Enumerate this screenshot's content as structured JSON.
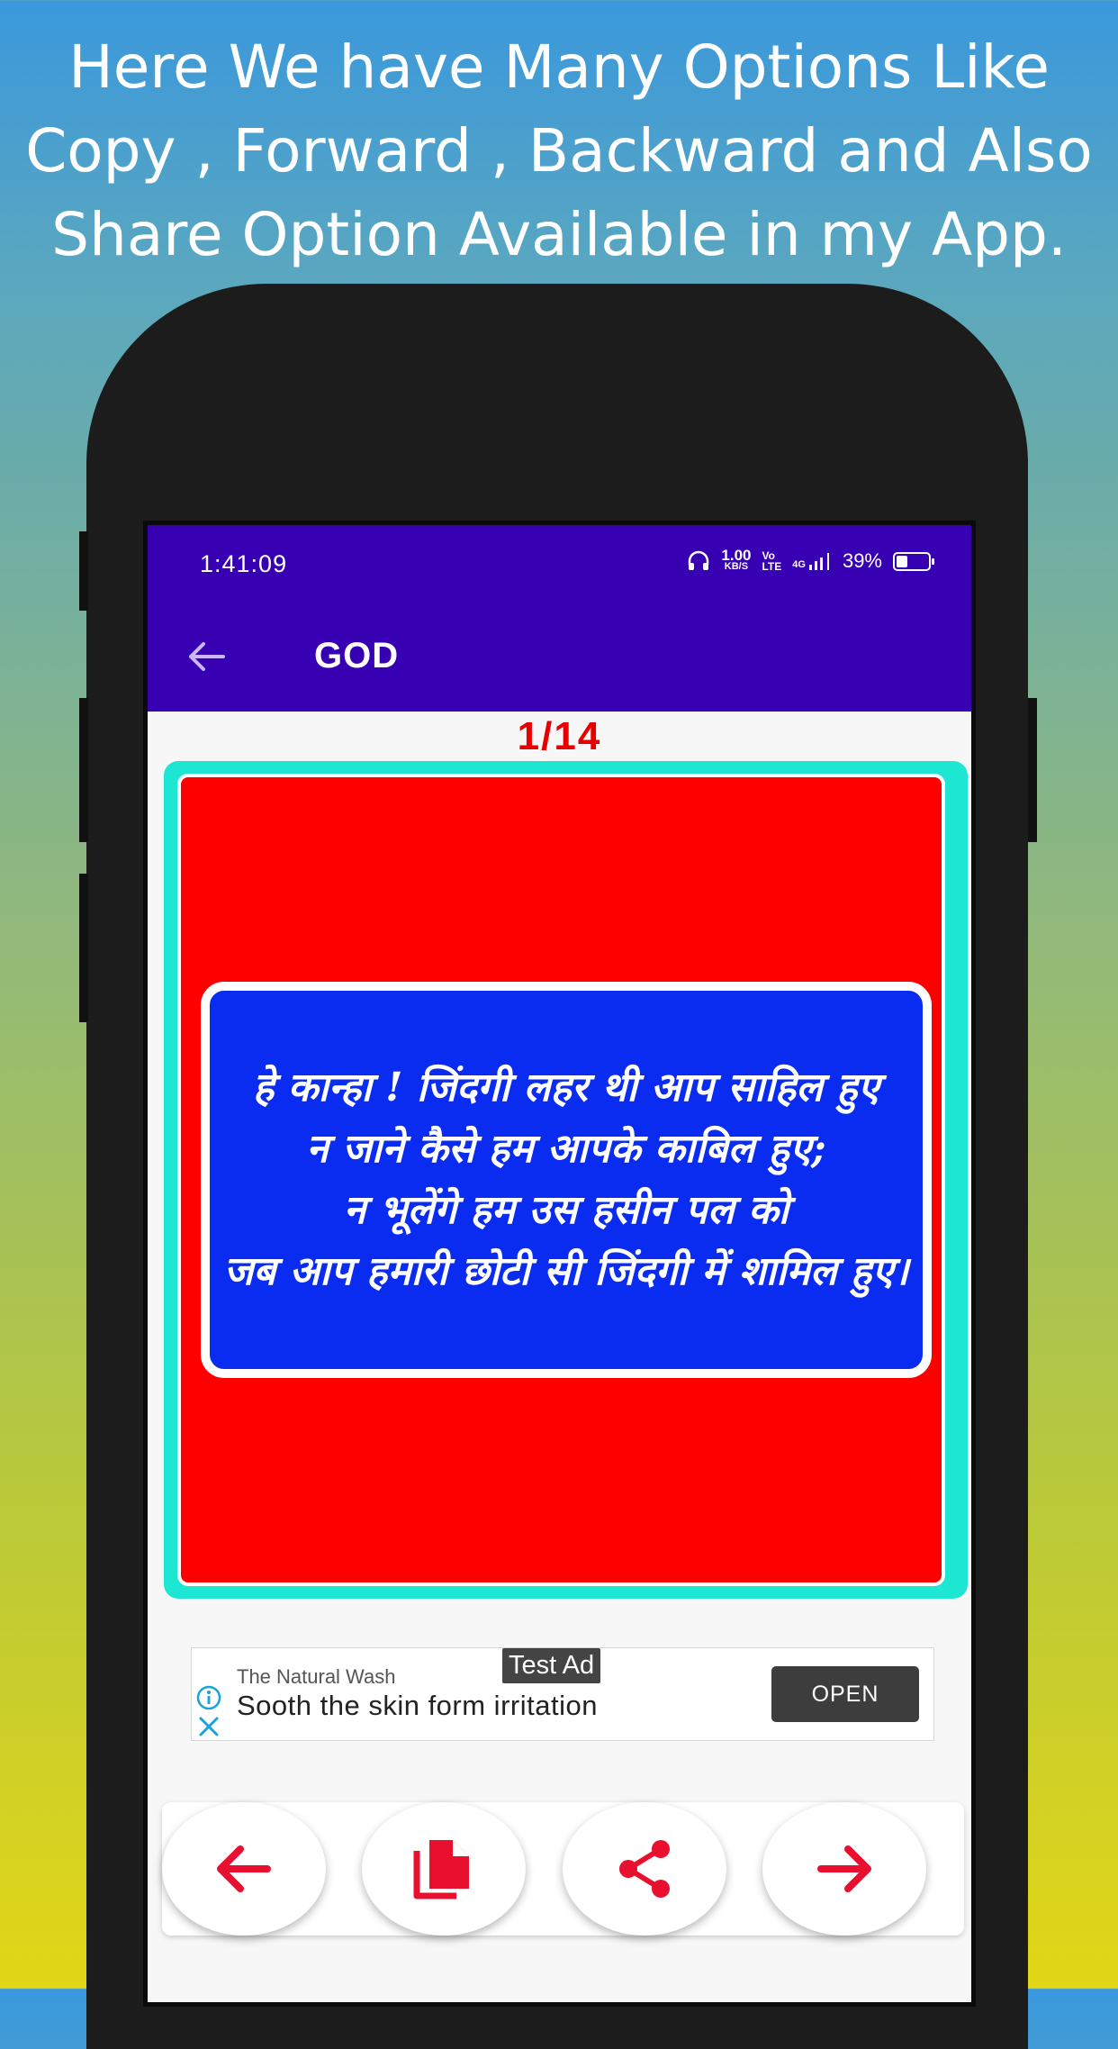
{
  "promo": {
    "line1": "Here We have Many Options Like",
    "line2": "Copy , Forward , Backward and Also",
    "line3": "Share Option Available in my App."
  },
  "statusbar": {
    "time": "1:41:09",
    "net_speed_value": "1.00",
    "net_speed_unit": "KB/S",
    "volte_top": "Vo",
    "volte_bottom": "LTE",
    "network": "4G",
    "battery_percent": "39%"
  },
  "appbar": {
    "title": "GOD"
  },
  "counter": {
    "text": "1/14"
  },
  "quote": {
    "text": "हे कान्हा ! जिंदगी लहर थी आप साहिल हुए\nन जाने कैसे हम आपके काबिल हुए;\nन भूलेंगे हम उस हसीन पल को\nजब आप हमारी छोटी सी जिंदगी में शामिल हुए।"
  },
  "ad": {
    "badge": "Test Ad",
    "advertiser": "The Natural Wash",
    "headline": "Sooth the skin form irritation",
    "cta": "OPEN"
  },
  "colors": {
    "appbar": "#3700b3",
    "counter": "#e60000",
    "card_border": "#1de6d2",
    "card_bg": "#ff0000",
    "quote_bg": "#0a2bf0",
    "icon": "#e8102e"
  },
  "toolbar": {
    "icons": [
      "arrow-back-icon",
      "copy-icon",
      "share-icon",
      "arrow-forward-icon"
    ]
  }
}
